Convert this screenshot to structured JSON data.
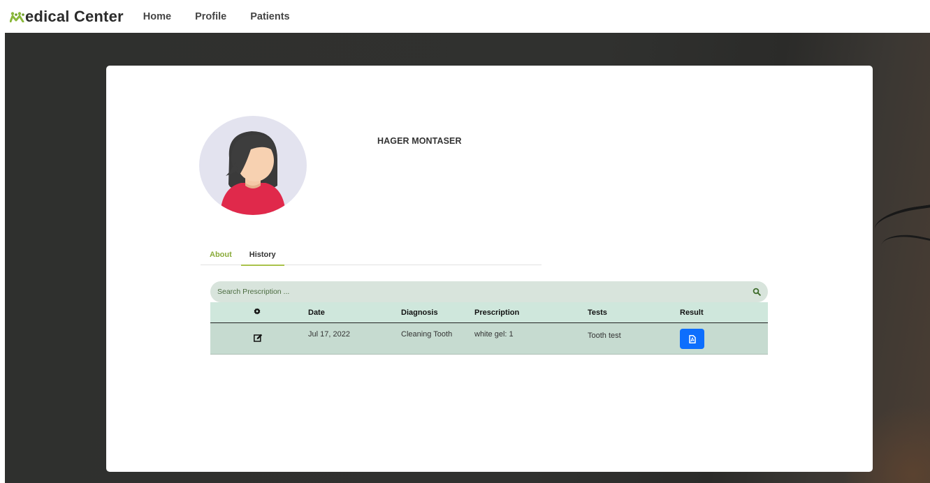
{
  "app": {
    "brand_first_letter_icon": "medical-logo-icon",
    "brand_text": "edical Center"
  },
  "nav": {
    "items": [
      {
        "label": "Home"
      },
      {
        "label": "Profile"
      },
      {
        "label": "Patients"
      }
    ]
  },
  "patient": {
    "name": "HAGER MONTASER",
    "avatar_icon": "female-avatar-icon"
  },
  "tabs": [
    {
      "label": "About",
      "active": false
    },
    {
      "label": "History",
      "active": true
    }
  ],
  "search": {
    "placeholder": "Search Prescription ...",
    "value": ""
  },
  "table": {
    "header_icon": "gear-icon",
    "columns": [
      "Date",
      "Diagnosis",
      "Prescription",
      "Tests",
      "Result"
    ],
    "rows": [
      {
        "action_icon": "edit-icon",
        "date": "Jul 17, 2022",
        "diagnosis": "Cleaning Tooth",
        "prescription": "white gel: 1",
        "tests": "Tooth test",
        "result_icon": "file-pdf-icon"
      }
    ]
  },
  "colors": {
    "accent_green": "#8aab3a",
    "search_bg": "#d8e4dc",
    "table_header_bg": "#cfe7dc",
    "table_row_bg": "#c6dbd0",
    "result_button": "#0d6efd"
  }
}
